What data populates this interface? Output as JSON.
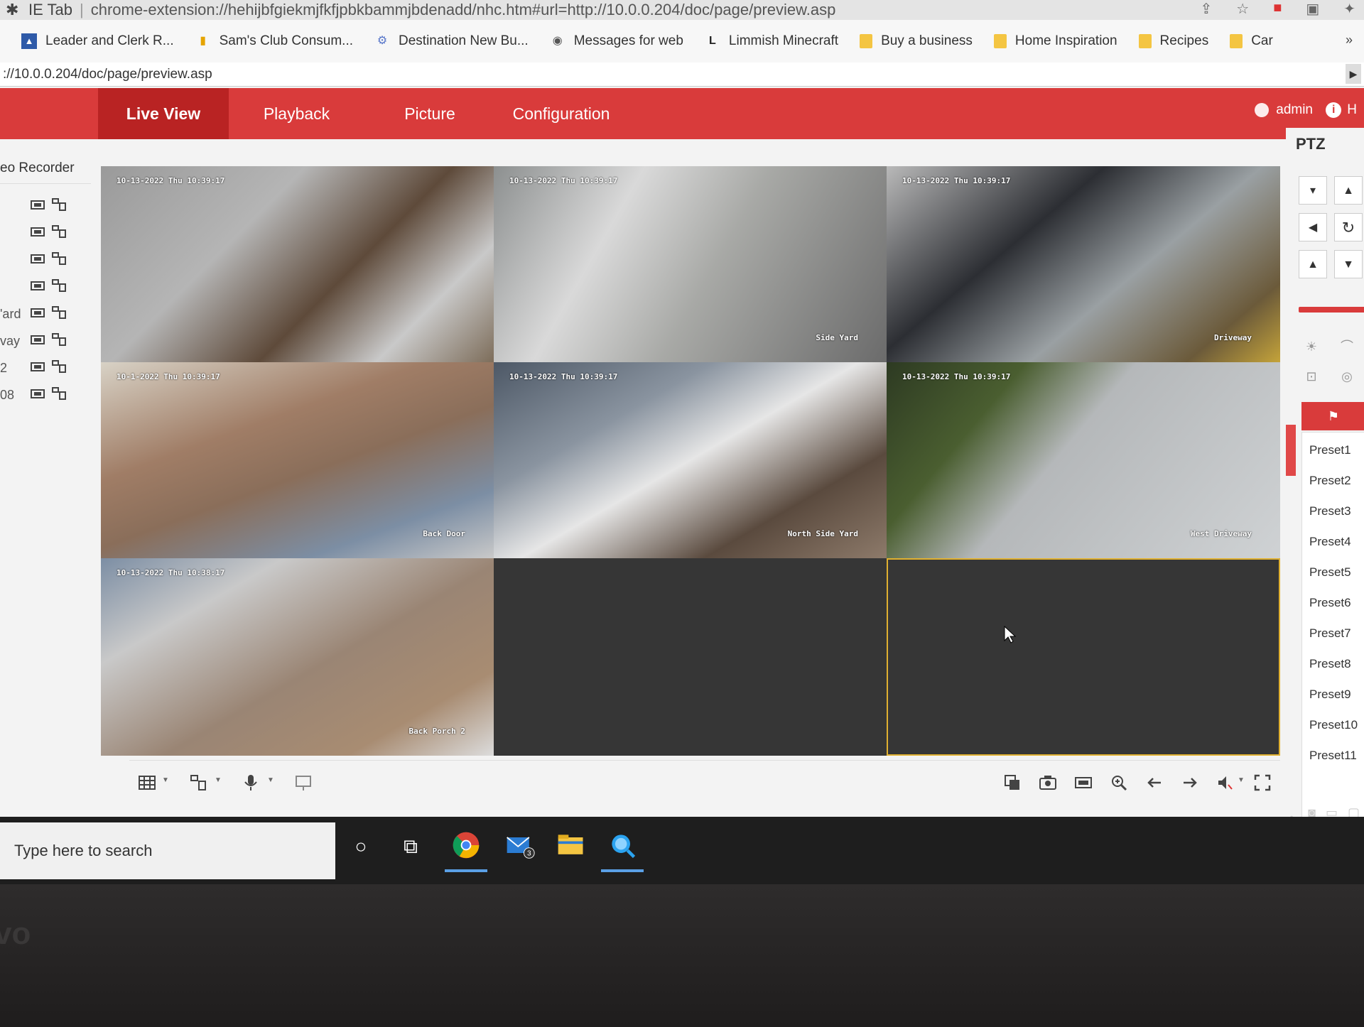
{
  "browser": {
    "tab_prefix": "IE Tab",
    "url": "chrome-extension://hehijbfgiekmjfkfjpbkbammjbdenadd/nhc.htm#url=http://10.0.0.204/doc/page/preview.asp",
    "bookmarks": [
      {
        "label": "Leader and Clerk R...",
        "icon": "leader-icon"
      },
      {
        "label": "Sam's Club Consum...",
        "icon": "sams-icon"
      },
      {
        "label": "Destination New Bu...",
        "icon": "gear-icon"
      },
      {
        "label": "Messages for web",
        "icon": "globe-icon"
      },
      {
        "label": "Limmish Minecraft",
        "icon": "l-icon"
      },
      {
        "label": "Buy a business",
        "icon": "folder-icon"
      },
      {
        "label": "Home Inspiration",
        "icon": "folder-icon"
      },
      {
        "label": "Recipes",
        "icon": "folder-icon"
      },
      {
        "label": "Car",
        "icon": "folder-icon"
      }
    ],
    "more": "»",
    "inner_url": "://10.0.0.204/doc/page/preview.asp"
  },
  "nav": {
    "tabs": [
      "Live View",
      "Playback",
      "Picture",
      "Configuration"
    ],
    "active": "Live View",
    "user": "admin",
    "help": "H"
  },
  "left_panel": {
    "title": "eo Recorder",
    "cameras": [
      "",
      "",
      "",
      "",
      "'ard",
      "vay",
      "2",
      "08"
    ]
  },
  "cameras": [
    {
      "timestamp": "10-13-2022 Thu 10:39:17",
      "name": ""
    },
    {
      "timestamp": "10-13-2022 Thu 10:39:17",
      "name": "Side Yard"
    },
    {
      "timestamp": "10-13-2022 Thu 10:39:17",
      "name": "Driveway"
    },
    {
      "timestamp": "10-1-2022 Thu 10:39:17",
      "name": "Back Door"
    },
    {
      "timestamp": "10-13-2022 Thu 10:39:17",
      "name": "North Side Yard"
    },
    {
      "timestamp": "10-13-2022 Thu 10:39:17",
      "name": "West Driveway"
    },
    {
      "timestamp": "10-13-2022 Thu 10:38:17",
      "name": "Back Porch 2"
    }
  ],
  "ptz": {
    "title": "PTZ",
    "presets": [
      "Preset1",
      "Preset2",
      "Preset3",
      "Preset4",
      "Preset5",
      "Preset6",
      "Preset7",
      "Preset8",
      "Preset9",
      "Preset10",
      "Preset11"
    ]
  },
  "taskbar": {
    "search_placeholder": "Type here to search",
    "mail_badge": "3"
  },
  "colors": {
    "accent": "#d93b3b",
    "selected_cell": "#e0b030"
  }
}
